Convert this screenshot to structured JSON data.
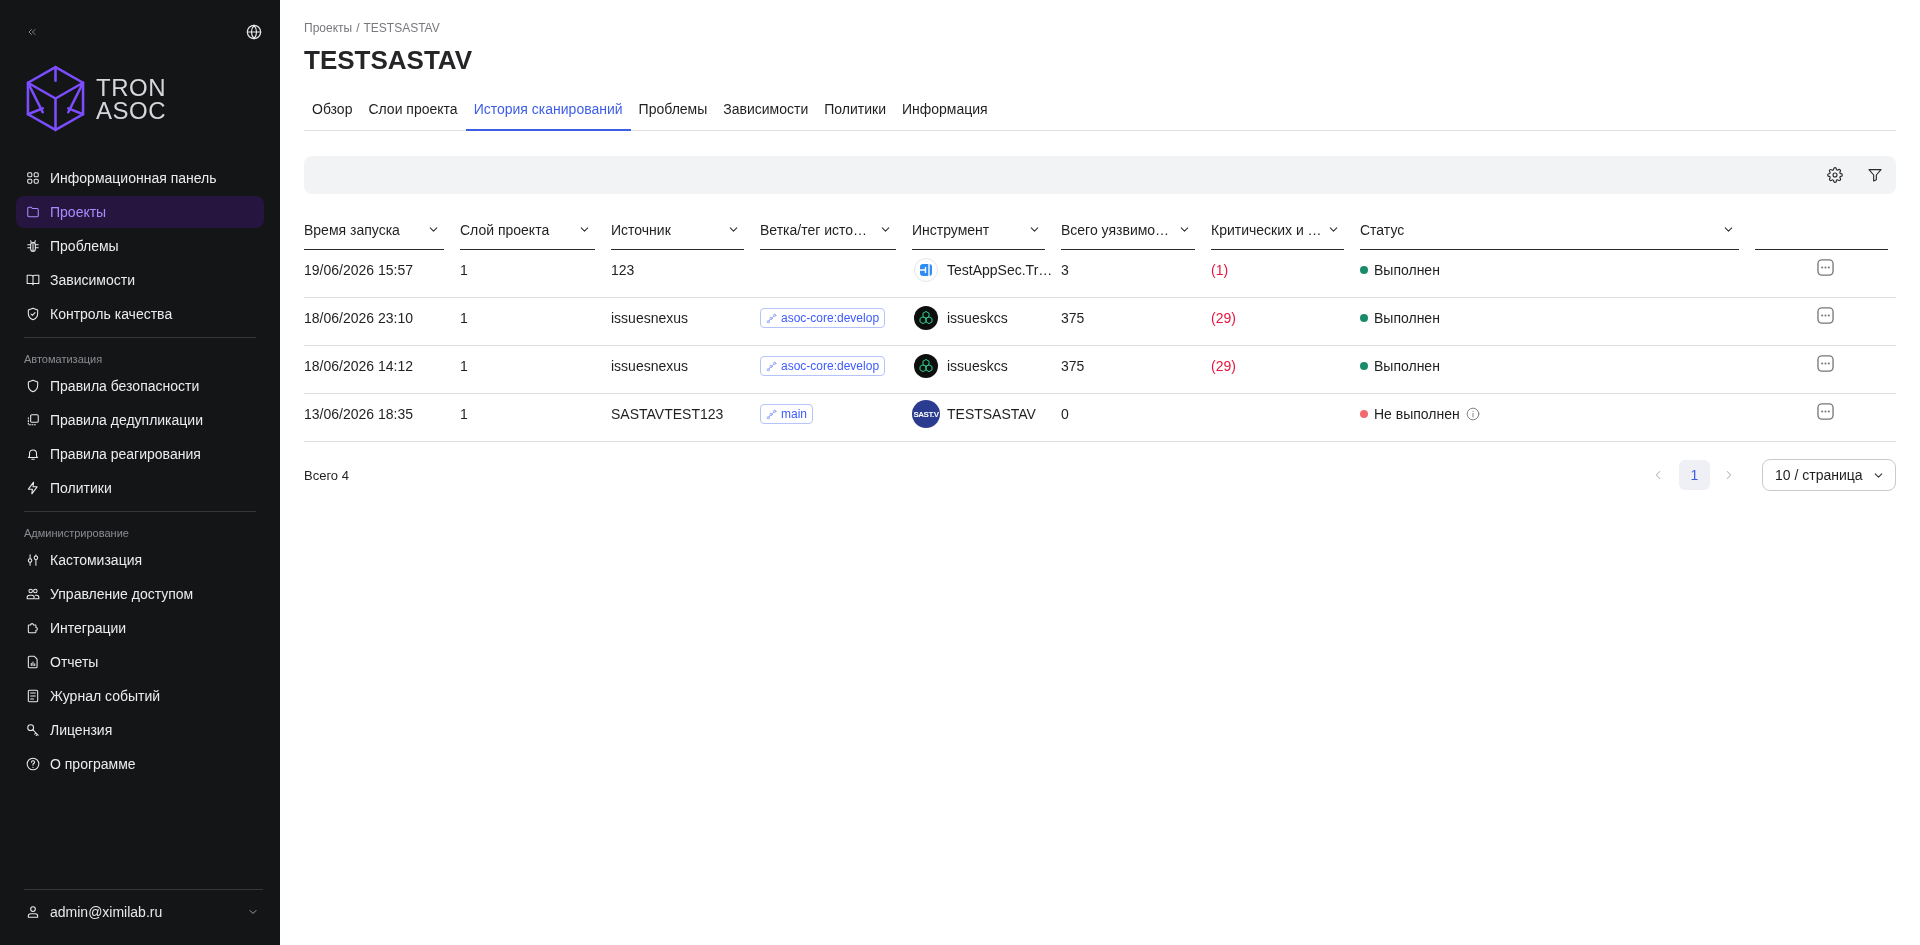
{
  "sidebar": {
    "logo": {
      "line1": "TRON",
      "line2": "ASOC"
    },
    "sections": [
      {
        "items": [
          {
            "label": "Информационная панель",
            "selected": false
          },
          {
            "label": "Проекты",
            "selected": true
          },
          {
            "label": "Проблемы",
            "selected": false
          },
          {
            "label": "Зависимости",
            "selected": false
          },
          {
            "label": "Контроль качества",
            "selected": false
          }
        ]
      },
      {
        "heading": "Автоматизация",
        "items": [
          {
            "label": "Правила безопасности",
            "selected": false
          },
          {
            "label": "Правила дедупликации",
            "selected": false
          },
          {
            "label": "Правила реагирования",
            "selected": false
          },
          {
            "label": "Политики",
            "selected": false
          }
        ]
      },
      {
        "heading": "Администрирование",
        "items": [
          {
            "label": "Кастомизация",
            "selected": false
          },
          {
            "label": "Управление доступом",
            "selected": false
          },
          {
            "label": "Интеграции",
            "selected": false
          },
          {
            "label": "Отчеты",
            "selected": false
          },
          {
            "label": "Журнал событий",
            "selected": false
          },
          {
            "label": "Лицензия",
            "selected": false
          },
          {
            "label": "О программе",
            "selected": false
          }
        ]
      }
    ],
    "user": {
      "name": "admin@ximilab.ru"
    }
  },
  "breadcrumb": {
    "items": [
      "Проекты",
      "TESTSASTAV"
    ],
    "separator": "/"
  },
  "title": "TESTSASTAV",
  "tabs": [
    {
      "label": "Обзор",
      "selected": false
    },
    {
      "label": "Слои проекта",
      "selected": false
    },
    {
      "label": "История сканирований",
      "selected": true
    },
    {
      "label": "Проблемы",
      "selected": false
    },
    {
      "label": "Зависимости",
      "selected": false
    },
    {
      "label": "Политики",
      "selected": false
    },
    {
      "label": "Информация",
      "selected": false
    }
  ],
  "table": {
    "columns": [
      "Время запуска",
      "Слой проекта",
      "Источник",
      "Ветка/тег исто…",
      "Инструмент",
      "Всего уязвимо…",
      "Критических и …",
      "Статус"
    ],
    "rows": [
      {
        "started": "19/06/2026 15:57",
        "layer": "1",
        "source": "123",
        "tool": {
          "kind": "appsec",
          "name": "TestAppSec.Tr…"
        },
        "total": "3",
        "critical": "(1)",
        "status": {
          "label": "Выполнен",
          "color": "#1b8a6b",
          "info": false
        }
      },
      {
        "started": "18/06/2026 23:10",
        "layer": "1",
        "source": "issuesnexus",
        "branch": "asoc-core:develop",
        "tool": {
          "kind": "kcs",
          "name": "issueskcs"
        },
        "total": "375",
        "critical": "(29)",
        "status": {
          "label": "Выполнен",
          "color": "#1b8a6b",
          "info": false
        }
      },
      {
        "started": "18/06/2026 14:12",
        "layer": "1",
        "source": "issuesnexus",
        "branch": "asoc-core:develop",
        "tool": {
          "kind": "kcs",
          "name": "issueskcs"
        },
        "total": "375",
        "critical": "(29)",
        "status": {
          "label": "Выполнен",
          "color": "#1b8a6b",
          "info": false
        }
      },
      {
        "started": "13/06/2026 18:35",
        "layer": "1",
        "source": "SASTAVTEST123",
        "branch": "main",
        "tool": {
          "kind": "sast",
          "name": "TESTSASTAV",
          "logo_text": "SAST.V"
        },
        "total": "0",
        "status": {
          "label": "Не выполнен",
          "color": "#f26b6b",
          "info": true
        }
      }
    ]
  },
  "pagination": {
    "total": "Всего 4",
    "pages": [
      {
        "label": "1",
        "selected": true
      }
    ],
    "page_size": "10 / страница"
  }
}
